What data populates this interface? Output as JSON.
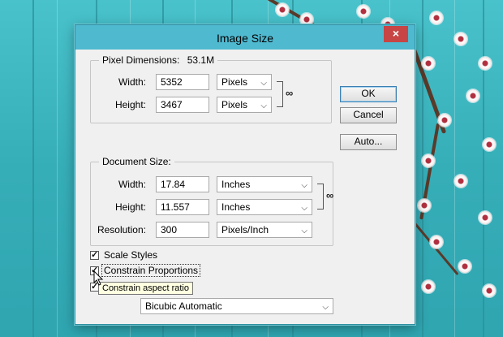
{
  "window": {
    "title": "Image Size",
    "close_glyph": "×"
  },
  "pixel_dimensions": {
    "legend": "Pixel Dimensions:",
    "size": "53.1M",
    "width_label": "Width:",
    "width_value": "5352",
    "width_unit": "Pixels",
    "height_label": "Height:",
    "height_value": "3467",
    "height_unit": "Pixels"
  },
  "document_size": {
    "legend": "Document Size:",
    "width_label": "Width:",
    "width_value": "17.84",
    "width_unit": "Inches",
    "height_label": "Height:",
    "height_value": "11.557",
    "height_unit": "Inches",
    "resolution_label": "Resolution:",
    "resolution_value": "300",
    "resolution_unit": "Pixels/Inch"
  },
  "options": {
    "scale_styles": {
      "label": "Scale Styles",
      "checked": true
    },
    "constrain_proportions": {
      "label": "Constrain Proportions",
      "checked": true
    },
    "resample": {
      "checked": true
    },
    "resample_method": "Bicubic Automatic"
  },
  "tooltip": "Constrain aspect ratio",
  "buttons": {
    "ok": "OK",
    "cancel": "Cancel",
    "auto": "Auto..."
  },
  "icons": {
    "link": "chain-link-icon",
    "dropdown": "chevron-down-icon",
    "check": "checkmark-icon"
  },
  "colors": {
    "titlebar": "#4fb9d0",
    "close": "#c74545",
    "background_wood": "#3fb8c2"
  }
}
